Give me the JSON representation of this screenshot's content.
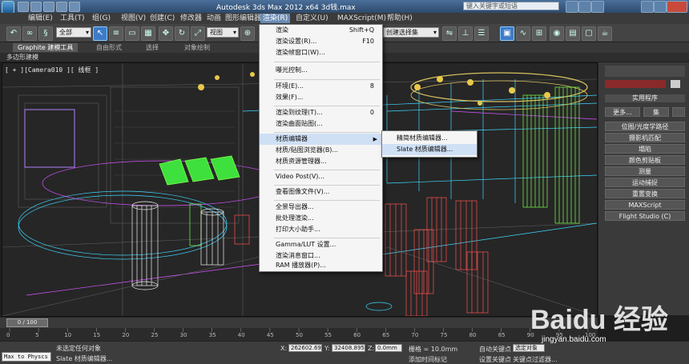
{
  "window": {
    "title": "Autodesk 3ds Max  2012 x64    3d钱.max",
    "search_placeholder": "键入关键字或短语"
  },
  "menubar": [
    "编辑(E)",
    "工具(T)",
    "组(G)",
    "视图(V)",
    "创建(C)",
    "修改器",
    "动画",
    "图形编辑器",
    "渲染(R)",
    "自定义(U)",
    "MAXScript(M)",
    "帮助(H)"
  ],
  "toolbar": {
    "selection_set": "全部",
    "view_dropdown": "视图",
    "named_selection": "创建选择集"
  },
  "ribbon": {
    "tabs": [
      "Graphite 建模工具",
      "自由形式",
      "选择",
      "对象绘制"
    ],
    "sub": "多边形建模"
  },
  "viewport": {
    "label": "[ + ][Camera010 ][ 线框 ]"
  },
  "render_menu": {
    "items": [
      {
        "label": "渲染",
        "shortcut": "Shift+Q"
      },
      {
        "label": "渲染设置(R)...",
        "shortcut": "F10"
      },
      {
        "label": "渲染帧窗口(W)...",
        "shortcut": ""
      },
      {
        "label": "曝光控制...",
        "shortcut": ""
      },
      {
        "label": "环境(E)...",
        "shortcut": "8"
      },
      {
        "label": "效果(F)...",
        "shortcut": ""
      },
      {
        "label": "渲染到纹理(T)...",
        "shortcut": "0"
      },
      {
        "label": "渲染曲面贴图(...",
        "shortcut": ""
      },
      {
        "label": "材质编辑器",
        "shortcut": ""
      },
      {
        "label": "材质/贴图浏览器(B)...",
        "shortcut": ""
      },
      {
        "label": "材质资源管理器...",
        "shortcut": ""
      },
      {
        "label": "Video Post(V)...",
        "shortcut": ""
      },
      {
        "label": "查看图像文件(V)...",
        "shortcut": ""
      },
      {
        "label": "全景导出器...",
        "shortcut": ""
      },
      {
        "label": "批处理渲染...",
        "shortcut": ""
      },
      {
        "label": "打印大小助手...",
        "shortcut": ""
      },
      {
        "label": "Gamma/LUT 设置...",
        "shortcut": ""
      },
      {
        "label": "渲染消息窗口...",
        "shortcut": ""
      },
      {
        "label": "RAM 播放器(P)...",
        "shortcut": ""
      }
    ],
    "submenu": [
      "精简材质编辑器...",
      "Slate 材质编辑器..."
    ]
  },
  "panel": {
    "header": "实用程序",
    "more": "更多...",
    "sets": "集",
    "buttons": [
      "位图/光度学路径",
      "摄影机匹配",
      "塌陷",
      "颜色剪贴板",
      "测量",
      "运动捕捉",
      "重置变换",
      "MAXScript",
      "Flight Studio (C)"
    ]
  },
  "timeline": {
    "frame": "0 / 100",
    "ticks": [
      "0",
      "5",
      "10",
      "15",
      "20",
      "25",
      "30",
      "35",
      "40",
      "45",
      "50",
      "55",
      "60",
      "65",
      "70",
      "75",
      "80",
      "85",
      "90",
      "95",
      "100"
    ]
  },
  "status": {
    "maxscript": "Max to Physcs",
    "selection": "未选定任何对象",
    "prompt": "Slate 材质编辑器...",
    "x_label": "X:",
    "x_value": "262602.69",
    "y_label": "Y:",
    "y_value": "32408.895",
    "z_label": "Z:",
    "z_value": "0.0mm",
    "grid": "栅格 = 10.0mm",
    "autokey": "自动关键点",
    "setkey": "设置关键点",
    "selected": "选定对象",
    "add_time": "添加时间标记",
    "key_filter": "关键点过滤器..."
  },
  "watermark": {
    "brand": "Baidu 经验",
    "url": "jingyan.baidu.com"
  },
  "colors": {
    "menu_highlight": "#6b8cb5",
    "wire_green": "#7cff4a",
    "wire_red": "#ff5050",
    "wire_cyan": "#3fd8ff",
    "wire_magenta": "#d455ff",
    "seat_green": "#3ee03e"
  }
}
